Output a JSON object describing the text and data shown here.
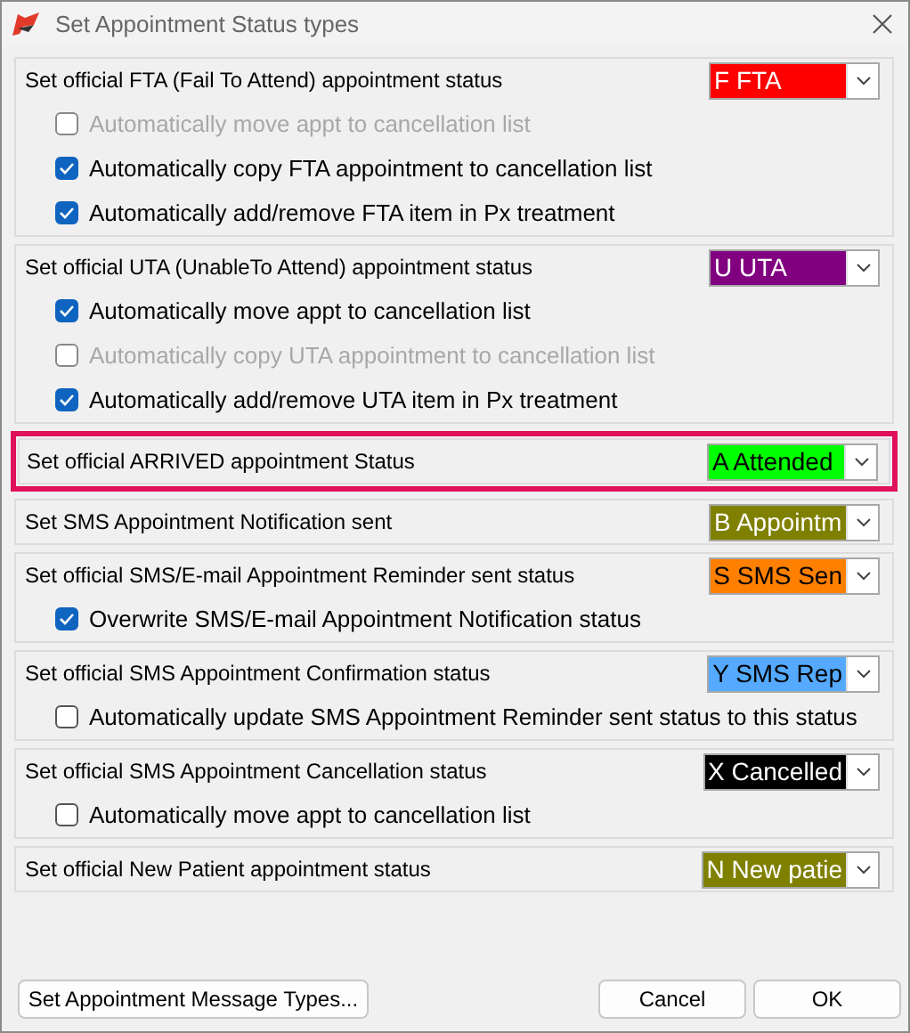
{
  "window": {
    "title": "Set Appointment Status types"
  },
  "groups": [
    {
      "label": "Set official FTA (Fail To Attend) appointment status",
      "highlighted": false,
      "status": {
        "text": "F FTA",
        "color": "#ff0000"
      },
      "options": [
        {
          "label": "Automatically move appt to cancellation list",
          "checked": false,
          "disabled": true
        },
        {
          "label": "Automatically copy FTA appointment to cancellation list",
          "checked": true,
          "disabled": false
        },
        {
          "label": "Automatically add/remove FTA item in Px treatment",
          "checked": true,
          "disabled": false
        }
      ]
    },
    {
      "label": "Set official UTA (UnableTo Attend) appointment status",
      "highlighted": false,
      "status": {
        "text": "U UTA",
        "color": "#800080"
      },
      "options": [
        {
          "label": "Automatically move appt to cancellation list",
          "checked": true,
          "disabled": false
        },
        {
          "label": "Automatically copy UTA appointment to cancellation list",
          "checked": false,
          "disabled": true
        },
        {
          "label": "Automatically add/remove UTA item in Px treatment",
          "checked": true,
          "disabled": false
        }
      ]
    },
    {
      "label": "Set official ARRIVED appointment Status",
      "highlighted": true,
      "status": {
        "text": "A Attended",
        "color": "#00ff00"
      }
    },
    {
      "label": "Set SMS Appointment Notification sent",
      "highlighted": false,
      "status": {
        "text": "B Appointm",
        "color": "#808000"
      }
    },
    {
      "label": "Set official SMS/E-mail Appointment Reminder sent status",
      "highlighted": false,
      "status": {
        "text": "S SMS Sen",
        "color": "#ff8000"
      },
      "options": [
        {
          "label": "Overwrite SMS/E-mail Appointment Notification status",
          "checked": true,
          "disabled": false
        }
      ]
    },
    {
      "label": "Set official SMS Appointment Confirmation status",
      "highlighted": false,
      "status": {
        "text": "Y SMS Rep",
        "color": "#55aaff"
      },
      "options": [
        {
          "label": "Automatically update SMS Appointment Reminder sent status to this status",
          "checked": false,
          "disabled": false
        }
      ]
    },
    {
      "label": "Set official SMS Appointment Cancellation status",
      "highlighted": false,
      "status": {
        "text": "X Cancelled",
        "color": "#000000"
      },
      "options": [
        {
          "label": "Automatically move appt to cancellation list",
          "checked": false,
          "disabled": false
        }
      ]
    },
    {
      "label": "Set official New Patient appointment status",
      "highlighted": false,
      "status": {
        "text": "N New patie",
        "color": "#808000"
      }
    }
  ],
  "buttons": {
    "left": "Set Appointment Message Types...",
    "cancel": "Cancel",
    "ok": "OK"
  }
}
